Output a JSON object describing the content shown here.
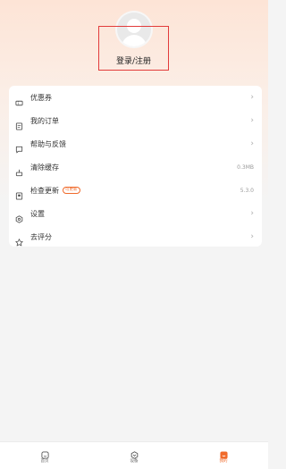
{
  "profile": {
    "login_label": "登录/注册"
  },
  "menu": [
    {
      "label": "优惠券",
      "icon": "coupon-icon",
      "right": ""
    },
    {
      "label": "我的订单",
      "icon": "order-icon",
      "right": ""
    },
    {
      "label": "帮助与反馈",
      "icon": "feedback-icon",
      "right": ""
    },
    {
      "label": "清除缓存",
      "icon": "clear-cache-icon",
      "right": "0.3MB"
    },
    {
      "label": "检查更新",
      "icon": "update-icon",
      "right": "5.3.0",
      "badge": "可更新"
    },
    {
      "label": "设置",
      "icon": "settings-icon",
      "right": ""
    },
    {
      "label": "去评分",
      "icon": "star-icon",
      "right": ""
    }
  ],
  "tabs": [
    {
      "label": "首页",
      "icon": "home-icon"
    },
    {
      "label": "设备",
      "icon": "device-icon"
    },
    {
      "label": "我的",
      "icon": "profile-icon"
    }
  ],
  "colors": {
    "accent": "#f06a2a",
    "highlight_box": "#e23b3b"
  }
}
